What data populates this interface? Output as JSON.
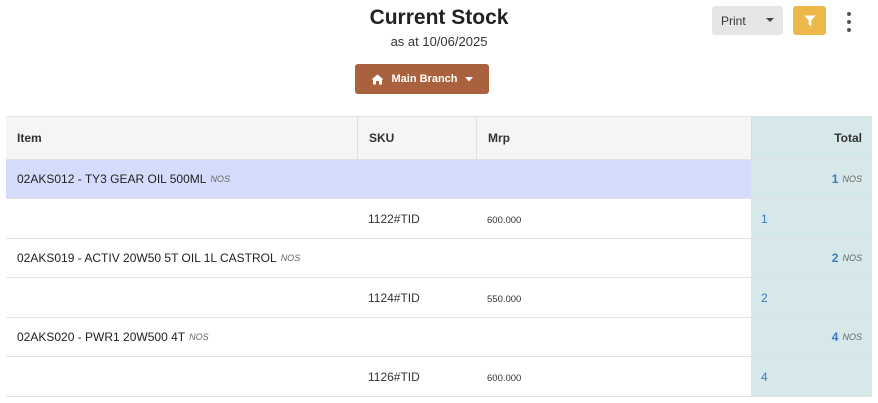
{
  "header": {
    "title": "Current Stock",
    "subtitle": "as at 10/06/2025",
    "branch_label": "Main Branch",
    "print_label": "Print"
  },
  "icons": {
    "branch": "home-icon",
    "filter": "filter-icon",
    "more": "kebab-menu-icon"
  },
  "colors": {
    "branch_button": "#a9623d",
    "filter_button": "#ecb84a",
    "highlight_row": "#d5dcfb",
    "total_column": "#d6e8e9",
    "link_blue": "#3a7bbf"
  },
  "table": {
    "columns": [
      "Item",
      "SKU",
      "Mrp",
      "Total"
    ],
    "products": [
      {
        "name": "02AKS012 - TY3 GEAR OIL 500ML",
        "unit": "NOS",
        "total": "1",
        "total_unit": "NOS",
        "detail": {
          "sku": "1122#TID",
          "mrp": "600.000",
          "qty": "1"
        }
      },
      {
        "name": "02AKS019 - ACTIV 20W50 5T OIL 1L CASTROL",
        "unit": "NOS",
        "total": "2",
        "total_unit": "NOS",
        "detail": {
          "sku": "1124#TID",
          "mrp": "550.000",
          "qty": "2"
        }
      },
      {
        "name": "02AKS020 - PWR1 20W500 4T",
        "unit": "NOS",
        "total": "4",
        "total_unit": "NOS",
        "detail": {
          "sku": "1126#TID",
          "mrp": "600.000",
          "qty": "4"
        }
      }
    ]
  }
}
